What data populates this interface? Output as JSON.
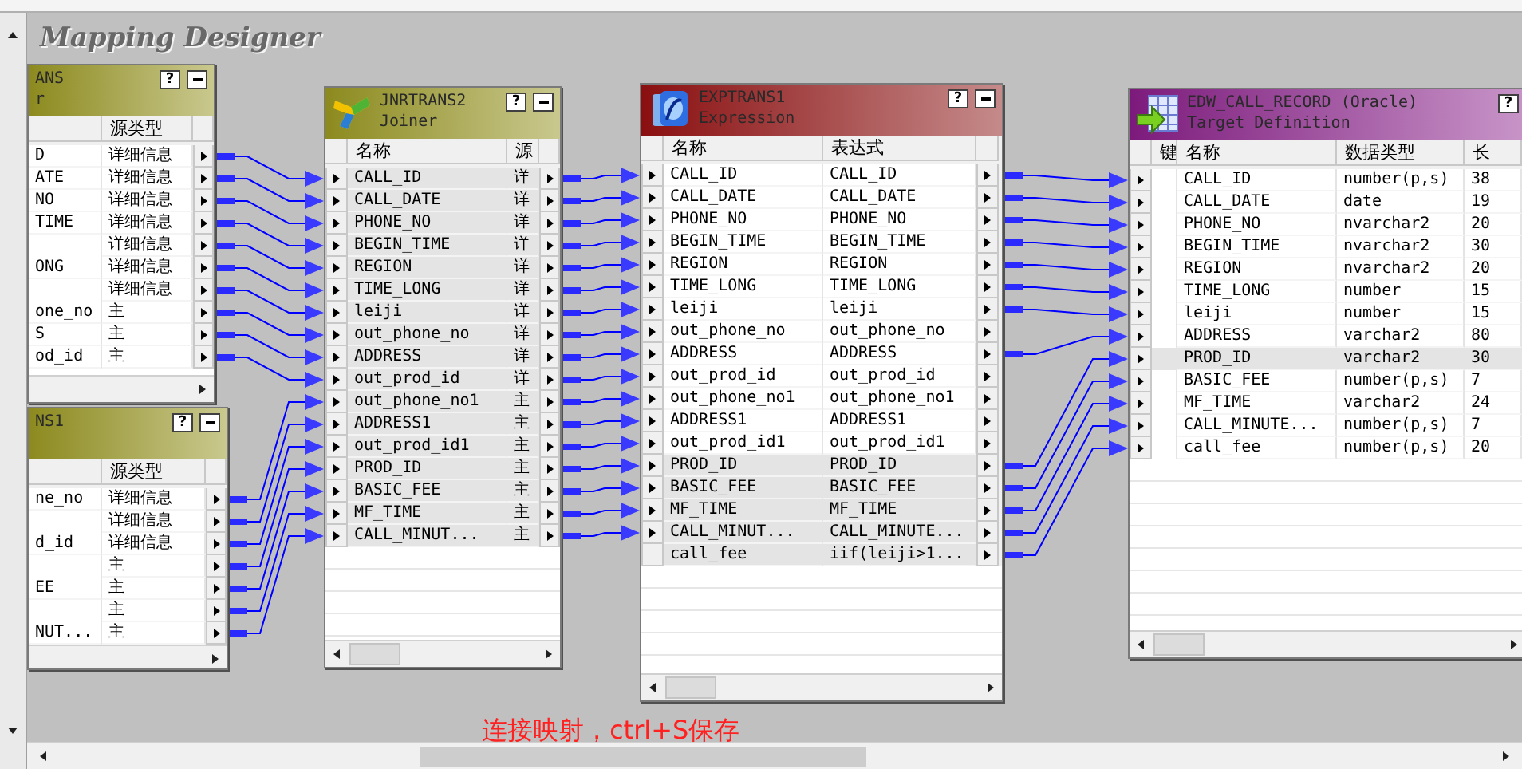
{
  "canvas_title": "Mapping Designer",
  "nodes": [
    {
      "kind": "qualifier",
      "title": "ANS",
      "subtitle": "r",
      "help": "?",
      "columns": [
        null,
        "源类型"
      ],
      "rows": [
        {
          "cells": [
            "D",
            "详细信息"
          ],
          "out": true,
          "selected": false
        },
        {
          "cells": [
            "ATE",
            "详细信息"
          ],
          "out": true,
          "selected": false
        },
        {
          "cells": [
            "NO",
            "详细信息"
          ],
          "out": true,
          "selected": false
        },
        {
          "cells": [
            "TIME",
            "详细信息"
          ],
          "out": true,
          "selected": false
        },
        {
          "cells": [
            null,
            "详细信息"
          ],
          "out": true,
          "selected": false
        },
        {
          "cells": [
            "ONG",
            "详细信息"
          ],
          "out": true,
          "selected": false
        },
        {
          "cells": [
            null,
            "详细信息"
          ],
          "out": true,
          "selected": false
        },
        {
          "cells": [
            "one_no",
            "主"
          ],
          "out": true,
          "selected": false
        },
        {
          "cells": [
            "S",
            "主"
          ],
          "out": true,
          "selected": false
        },
        {
          "cells": [
            "od_id",
            "主"
          ],
          "out": true,
          "selected": false
        }
      ]
    },
    {
      "kind": "qualifier",
      "title": "NS1",
      "help": "?",
      "columns": [
        null,
        "源类型"
      ],
      "rows": [
        {
          "cells": [
            "ne_no",
            "详细信息"
          ],
          "out": true,
          "selected": false
        },
        {
          "cells": [
            null,
            "详细信息"
          ],
          "out": true,
          "selected": false
        },
        {
          "cells": [
            "d_id",
            "详细信息"
          ],
          "out": true,
          "selected": false
        },
        {
          "cells": [
            null,
            "主"
          ],
          "out": true,
          "selected": false
        },
        {
          "cells": [
            "EE",
            "主"
          ],
          "out": true,
          "selected": false
        },
        {
          "cells": [
            null,
            "主"
          ],
          "out": true,
          "selected": false
        },
        {
          "cells": [
            "NUT...",
            "主"
          ],
          "out": true,
          "selected": false
        }
      ]
    },
    {
      "kind": "joiner",
      "title": "JNRTRANS2",
      "subtitle": "Joiner",
      "help": "?",
      "columns": [
        "名称",
        "源"
      ],
      "rows": [
        {
          "cells": [
            "CALL_ID",
            "详"
          ],
          "in": true,
          "out": true,
          "selected": true
        },
        {
          "cells": [
            "CALL_DATE",
            "详"
          ],
          "in": true,
          "out": true,
          "selected": true
        },
        {
          "cells": [
            "PHONE_NO",
            "详"
          ],
          "in": true,
          "out": true,
          "selected": true
        },
        {
          "cells": [
            "BEGIN_TIME",
            "详"
          ],
          "in": true,
          "out": true,
          "selected": true
        },
        {
          "cells": [
            "REGION",
            "详"
          ],
          "in": true,
          "out": true,
          "selected": true
        },
        {
          "cells": [
            "TIME_LONG",
            "详"
          ],
          "in": true,
          "out": true,
          "selected": true
        },
        {
          "cells": [
            "leiji",
            "详"
          ],
          "in": true,
          "out": true,
          "selected": true
        },
        {
          "cells": [
            "out_phone_no",
            "详"
          ],
          "in": true,
          "out": true,
          "selected": true
        },
        {
          "cells": [
            "ADDRESS",
            "详"
          ],
          "in": true,
          "out": true,
          "selected": true
        },
        {
          "cells": [
            "out_prod_id",
            "详"
          ],
          "in": true,
          "out": true,
          "selected": true
        },
        {
          "cells": [
            "out_phone_no1",
            "主"
          ],
          "in": true,
          "out": true,
          "selected": true
        },
        {
          "cells": [
            "ADDRESS1",
            "主"
          ],
          "in": true,
          "out": true,
          "selected": true
        },
        {
          "cells": [
            "out_prod_id1",
            "主"
          ],
          "in": true,
          "out": true,
          "selected": true
        },
        {
          "cells": [
            "PROD_ID",
            "主"
          ],
          "in": true,
          "out": true,
          "selected": true
        },
        {
          "cells": [
            "BASIC_FEE",
            "主"
          ],
          "in": true,
          "out": true,
          "selected": true
        },
        {
          "cells": [
            "MF_TIME",
            "主"
          ],
          "in": true,
          "out": true,
          "selected": true
        },
        {
          "cells": [
            "CALL_MINUT...",
            "主"
          ],
          "in": true,
          "out": true,
          "selected": true
        }
      ]
    },
    {
      "kind": "expression",
      "title": "EXPTRANS1",
      "subtitle": "Expression",
      "help": "?",
      "columns": [
        "名称",
        "表达式"
      ],
      "rows": [
        {
          "cells": [
            "CALL_ID",
            "CALL_ID"
          ],
          "in": true,
          "out": true,
          "selected": false
        },
        {
          "cells": [
            "CALL_DATE",
            "CALL_DATE"
          ],
          "in": true,
          "out": true,
          "selected": false
        },
        {
          "cells": [
            "PHONE_NO",
            "PHONE_NO"
          ],
          "in": true,
          "out": true,
          "selected": false
        },
        {
          "cells": [
            "BEGIN_TIME",
            "BEGIN_TIME"
          ],
          "in": true,
          "out": true,
          "selected": false
        },
        {
          "cells": [
            "REGION",
            "REGION"
          ],
          "in": true,
          "out": true,
          "selected": false
        },
        {
          "cells": [
            "TIME_LONG",
            "TIME_LONG"
          ],
          "in": true,
          "out": true,
          "selected": false
        },
        {
          "cells": [
            "leiji",
            "leiji"
          ],
          "in": true,
          "out": true,
          "selected": false
        },
        {
          "cells": [
            "out_phone_no",
            "out_phone_no"
          ],
          "in": true,
          "out": true,
          "selected": false
        },
        {
          "cells": [
            "ADDRESS",
            "ADDRESS"
          ],
          "in": true,
          "out": true,
          "selected": false
        },
        {
          "cells": [
            "out_prod_id",
            "out_prod_id"
          ],
          "in": true,
          "out": true,
          "selected": false
        },
        {
          "cells": [
            "out_phone_no1",
            "out_phone_no1"
          ],
          "in": true,
          "out": true,
          "selected": false
        },
        {
          "cells": [
            "ADDRESS1",
            "ADDRESS1"
          ],
          "in": true,
          "out": true,
          "selected": false
        },
        {
          "cells": [
            "out_prod_id1",
            "out_prod_id1"
          ],
          "in": true,
          "out": true,
          "selected": false
        },
        {
          "cells": [
            "PROD_ID",
            "PROD_ID"
          ],
          "in": true,
          "out": true,
          "selected": true
        },
        {
          "cells": [
            "BASIC_FEE",
            "BASIC_FEE"
          ],
          "in": true,
          "out": true,
          "selected": true
        },
        {
          "cells": [
            "MF_TIME",
            "MF_TIME"
          ],
          "in": true,
          "out": true,
          "selected": true
        },
        {
          "cells": [
            "CALL_MINUT...",
            "CALL_MINUTE..."
          ],
          "in": true,
          "out": true,
          "selected": true
        },
        {
          "cells": [
            "call_fee",
            "iif(leiji>1..."
          ],
          "in": false,
          "out": true,
          "selected": true
        }
      ]
    },
    {
      "kind": "target",
      "title": "EDW_CALL_RECORD (Oracle)",
      "subtitle": "Target Definition",
      "help": "?",
      "columns": [
        "键",
        "名称",
        "数据类型",
        "长"
      ],
      "rows": [
        {
          "cells": [
            null,
            "CALL_ID",
            "number(p,s)",
            "38"
          ],
          "in": true,
          "selected": false
        },
        {
          "cells": [
            null,
            "CALL_DATE",
            "date",
            "19"
          ],
          "in": true,
          "selected": false
        },
        {
          "cells": [
            null,
            "PHONE_NO",
            "nvarchar2",
            "20"
          ],
          "in": true,
          "selected": false
        },
        {
          "cells": [
            null,
            "BEGIN_TIME",
            "nvarchar2",
            "30"
          ],
          "in": true,
          "selected": false
        },
        {
          "cells": [
            null,
            "REGION",
            "nvarchar2",
            "20"
          ],
          "in": true,
          "selected": false
        },
        {
          "cells": [
            null,
            "TIME_LONG",
            "number",
            "15"
          ],
          "in": true,
          "selected": false
        },
        {
          "cells": [
            null,
            "leiji",
            "number",
            "15"
          ],
          "in": true,
          "selected": false
        },
        {
          "cells": [
            null,
            "ADDRESS",
            "varchar2",
            "80"
          ],
          "in": true,
          "selected": false
        },
        {
          "cells": [
            null,
            "PROD_ID",
            "varchar2",
            "30"
          ],
          "in": true,
          "selected": true
        },
        {
          "cells": [
            null,
            "BASIC_FEE",
            "number(p,s)",
            "7"
          ],
          "in": true,
          "selected": false
        },
        {
          "cells": [
            null,
            "MF_TIME",
            "varchar2",
            "24"
          ],
          "in": true,
          "selected": false
        },
        {
          "cells": [
            null,
            "CALL_MINUTE...",
            "number(p,s)",
            "7"
          ],
          "in": true,
          "selected": false
        },
        {
          "cells": [
            null,
            "call_fee",
            "number(p,s)",
            "20"
          ],
          "in": true,
          "selected": false
        }
      ]
    }
  ],
  "caption": "连接映射，ctrl+S保存"
}
